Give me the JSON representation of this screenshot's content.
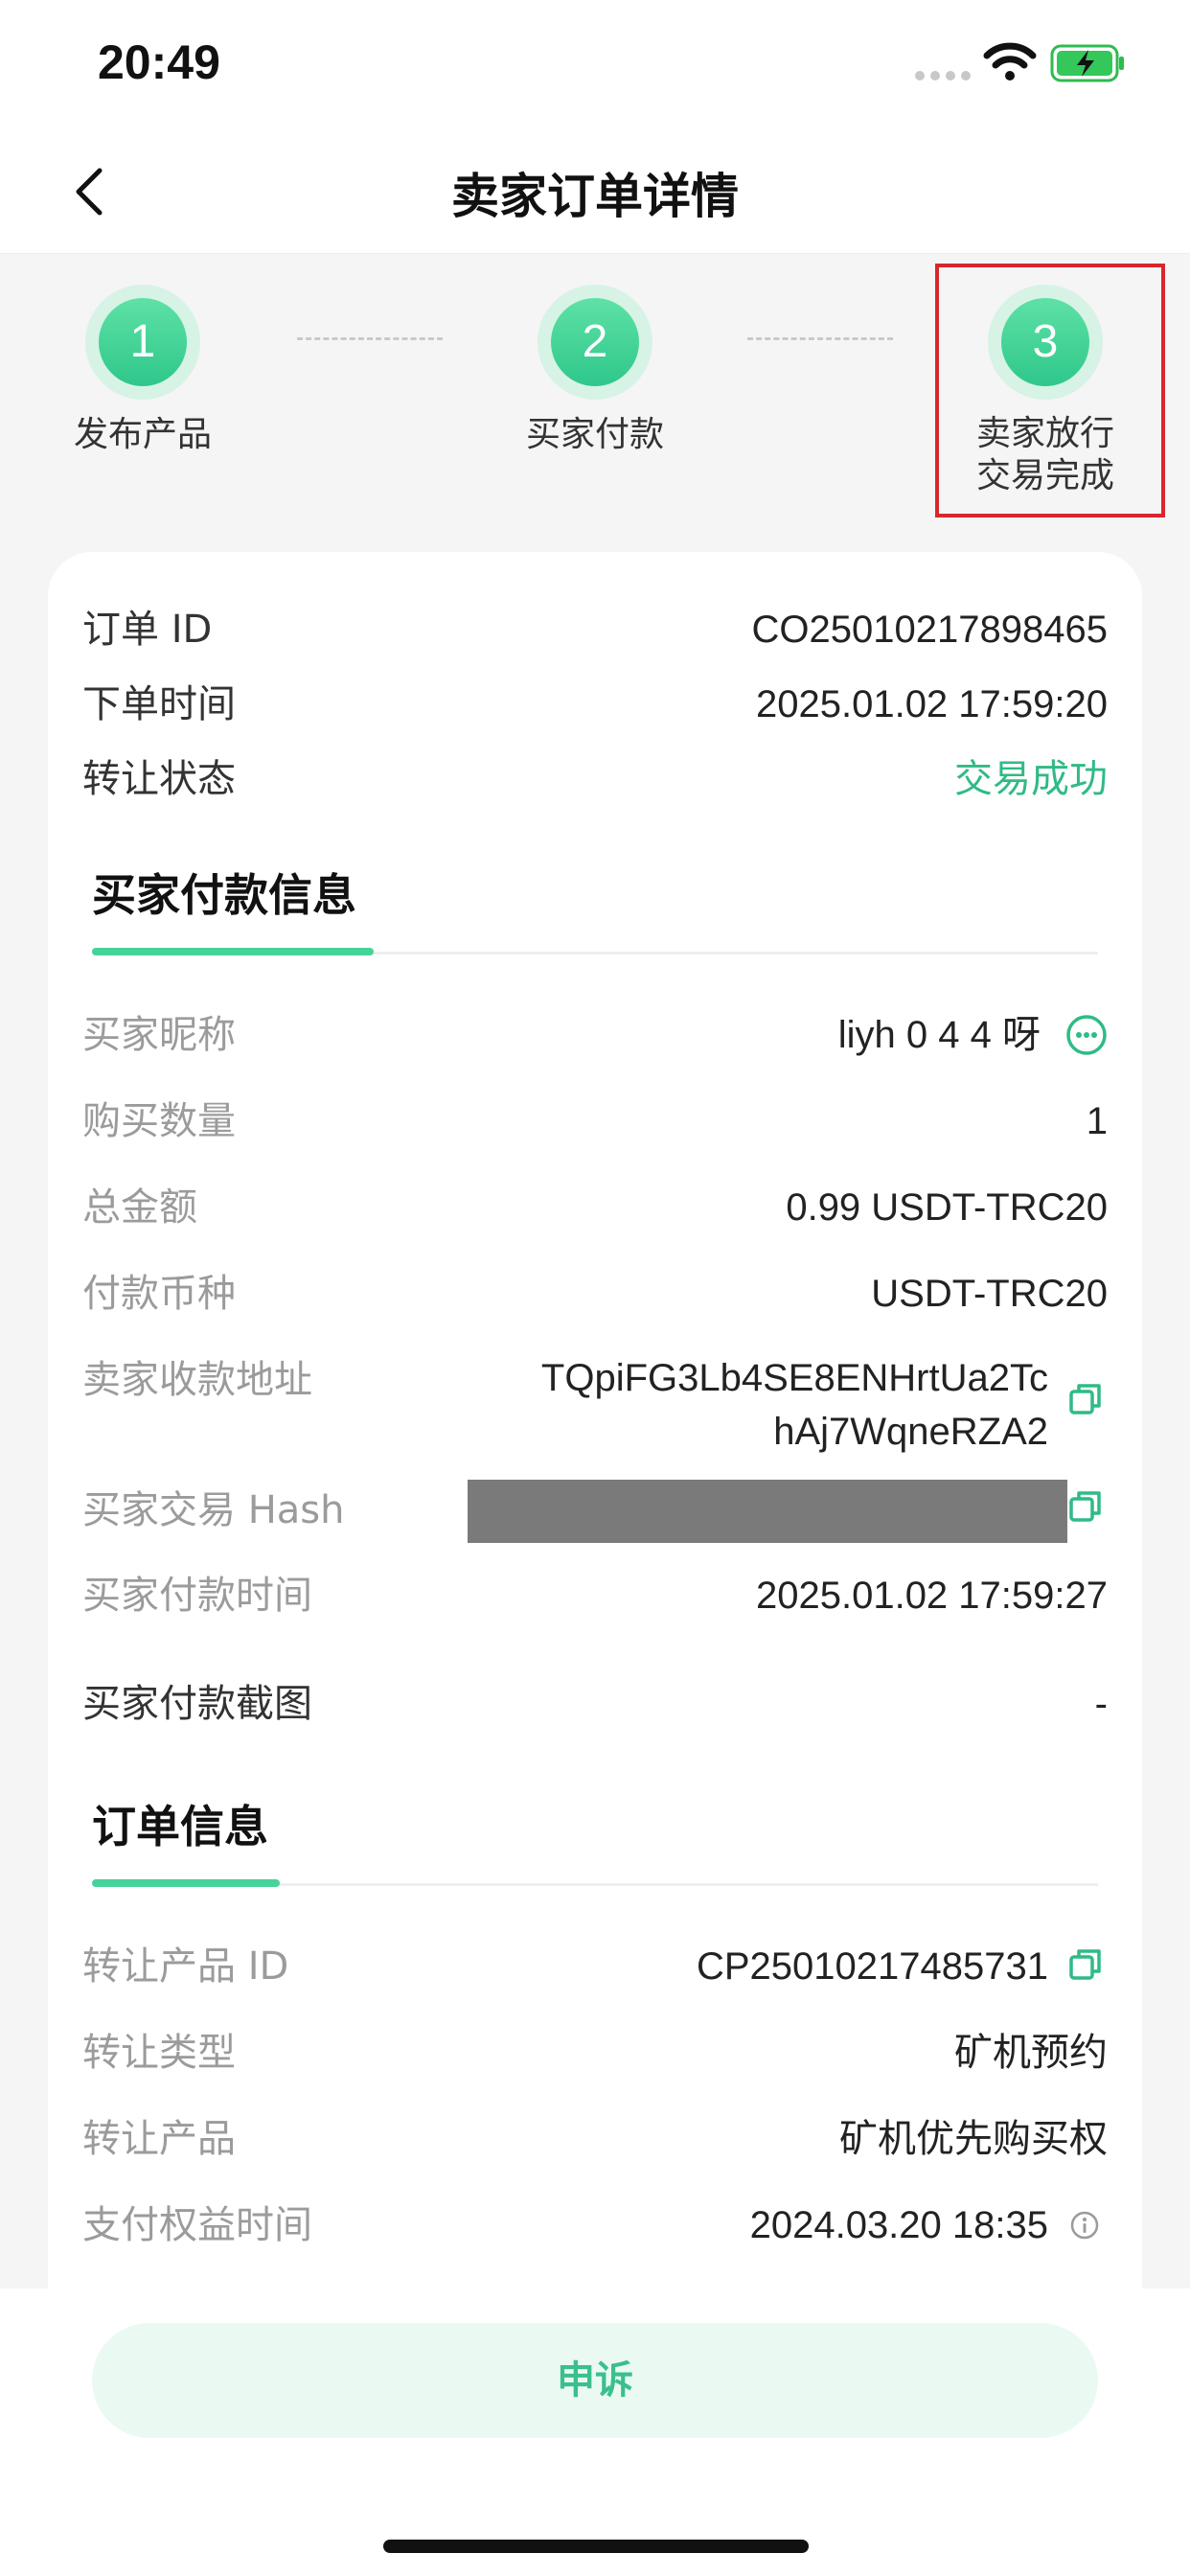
{
  "status_bar": {
    "time": "20:49"
  },
  "nav": {
    "title": "卖家订单详情"
  },
  "steps": [
    {
      "number": "1",
      "label": "发布产品"
    },
    {
      "number": "2",
      "label": "买家付款"
    },
    {
      "number": "3",
      "label_line1": "卖家放行",
      "label_line2": "交易完成"
    }
  ],
  "order_summary": {
    "order_id_label": "订单 ID",
    "order_id_value": "CO25010217898465",
    "order_time_label": "下单时间",
    "order_time_value": "2025.01.02 17:59:20",
    "status_label": "转让状态",
    "status_value": "交易成功"
  },
  "buyer_payment": {
    "section_title": "买家付款信息",
    "nickname_label": "买家昵称",
    "nickname_value": "liyh 0 4 4  呀",
    "quantity_label": "购买数量",
    "quantity_value": "1",
    "total_label": "总金额",
    "total_value": "0.99 USDT-TRC20",
    "currency_label": "付款币种",
    "currency_value": "USDT-TRC20",
    "address_label": "卖家收款地址",
    "address_line1": "TQpiFG3Lb4SE8ENHrtUa2Tc",
    "address_line2": "hAj7WqneRZA2",
    "hash_label": "买家交易 Hash",
    "pay_time_label": "买家付款时间",
    "pay_time_value": "2025.01.02 17:59:27",
    "screenshot_label": "买家付款截图",
    "screenshot_value": "-"
  },
  "order_info": {
    "section_title": "订单信息",
    "product_id_label": "转让产品 ID",
    "product_id_value": "CP25010217485731",
    "type_label": "转让类型",
    "type_value": "矿机预约",
    "product_label": "转让产品",
    "product_value": "矿机优先购买权",
    "benefit_time_label": "支付权益时间",
    "benefit_time_value": "2024.03.20 18:35"
  },
  "bottom": {
    "appeal_label": "申诉"
  },
  "colors": {
    "accent": "#2fbb85",
    "highlight": "#d9262c"
  }
}
